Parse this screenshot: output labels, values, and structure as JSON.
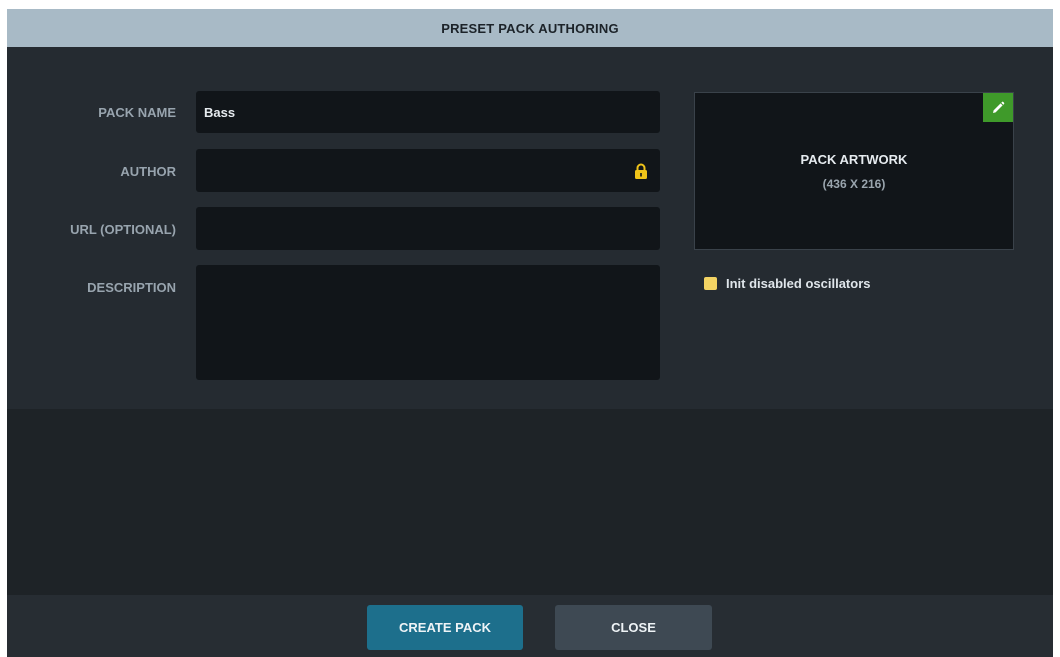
{
  "dialog": {
    "title": "PRESET PACK AUTHORING"
  },
  "form": {
    "pack_name": {
      "label": "PACK NAME",
      "value": "Bass"
    },
    "author": {
      "label": "AUTHOR",
      "value": "",
      "locked": true
    },
    "url": {
      "label": "URL (OPTIONAL)",
      "value": ""
    },
    "description": {
      "label": "DESCRIPTION",
      "value": ""
    }
  },
  "artwork": {
    "title": "PACK ARTWORK",
    "size": "(436 X 216)"
  },
  "options": {
    "init_disabled_oscillators": {
      "label": "Init disabled oscillators",
      "checked": true
    }
  },
  "footer": {
    "create_label": "CREATE PACK",
    "close_label": "CLOSE"
  },
  "colors": {
    "titlebar": "#a8bac6",
    "accent_primary": "#1d6f8c",
    "edit_green": "#3f9a2a",
    "checkbox_yellow": "#f3d363",
    "lock_yellow": "#f0c419"
  }
}
